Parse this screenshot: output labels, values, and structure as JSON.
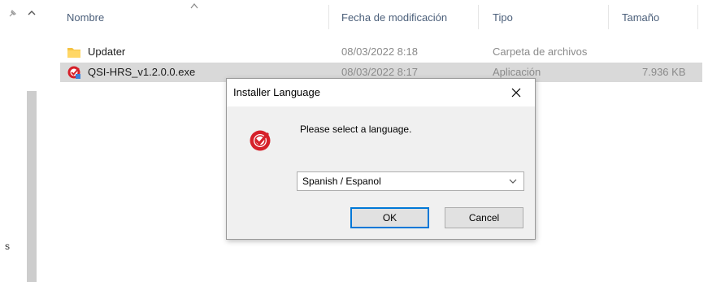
{
  "nav": {
    "side_letter": "s"
  },
  "columns": {
    "name": "Nombre",
    "modified": "Fecha de modificación",
    "type": "Tipo",
    "size": "Tamaño"
  },
  "files": [
    {
      "name": "Updater",
      "modified": "08/03/2022 8:18",
      "type": "Carpeta de archivos",
      "size": "",
      "icon": "folder-icon"
    },
    {
      "name": "QSI-HRS_v1.2.0.0.exe",
      "modified": "08/03/2022 8:17",
      "type": "Aplicación",
      "size": "7.936 KB",
      "icon": "installer-app-icon"
    }
  ],
  "dialog": {
    "title": "Installer Language",
    "prompt": "Please select a language.",
    "selected_language": "Spanish / Espanol",
    "ok_label": "OK",
    "cancel_label": "Cancel"
  },
  "colors": {
    "accent": "#0078d7",
    "selected_row": "#d9d9d9",
    "brand_red": "#d6202a",
    "folder": "#f5c342"
  }
}
